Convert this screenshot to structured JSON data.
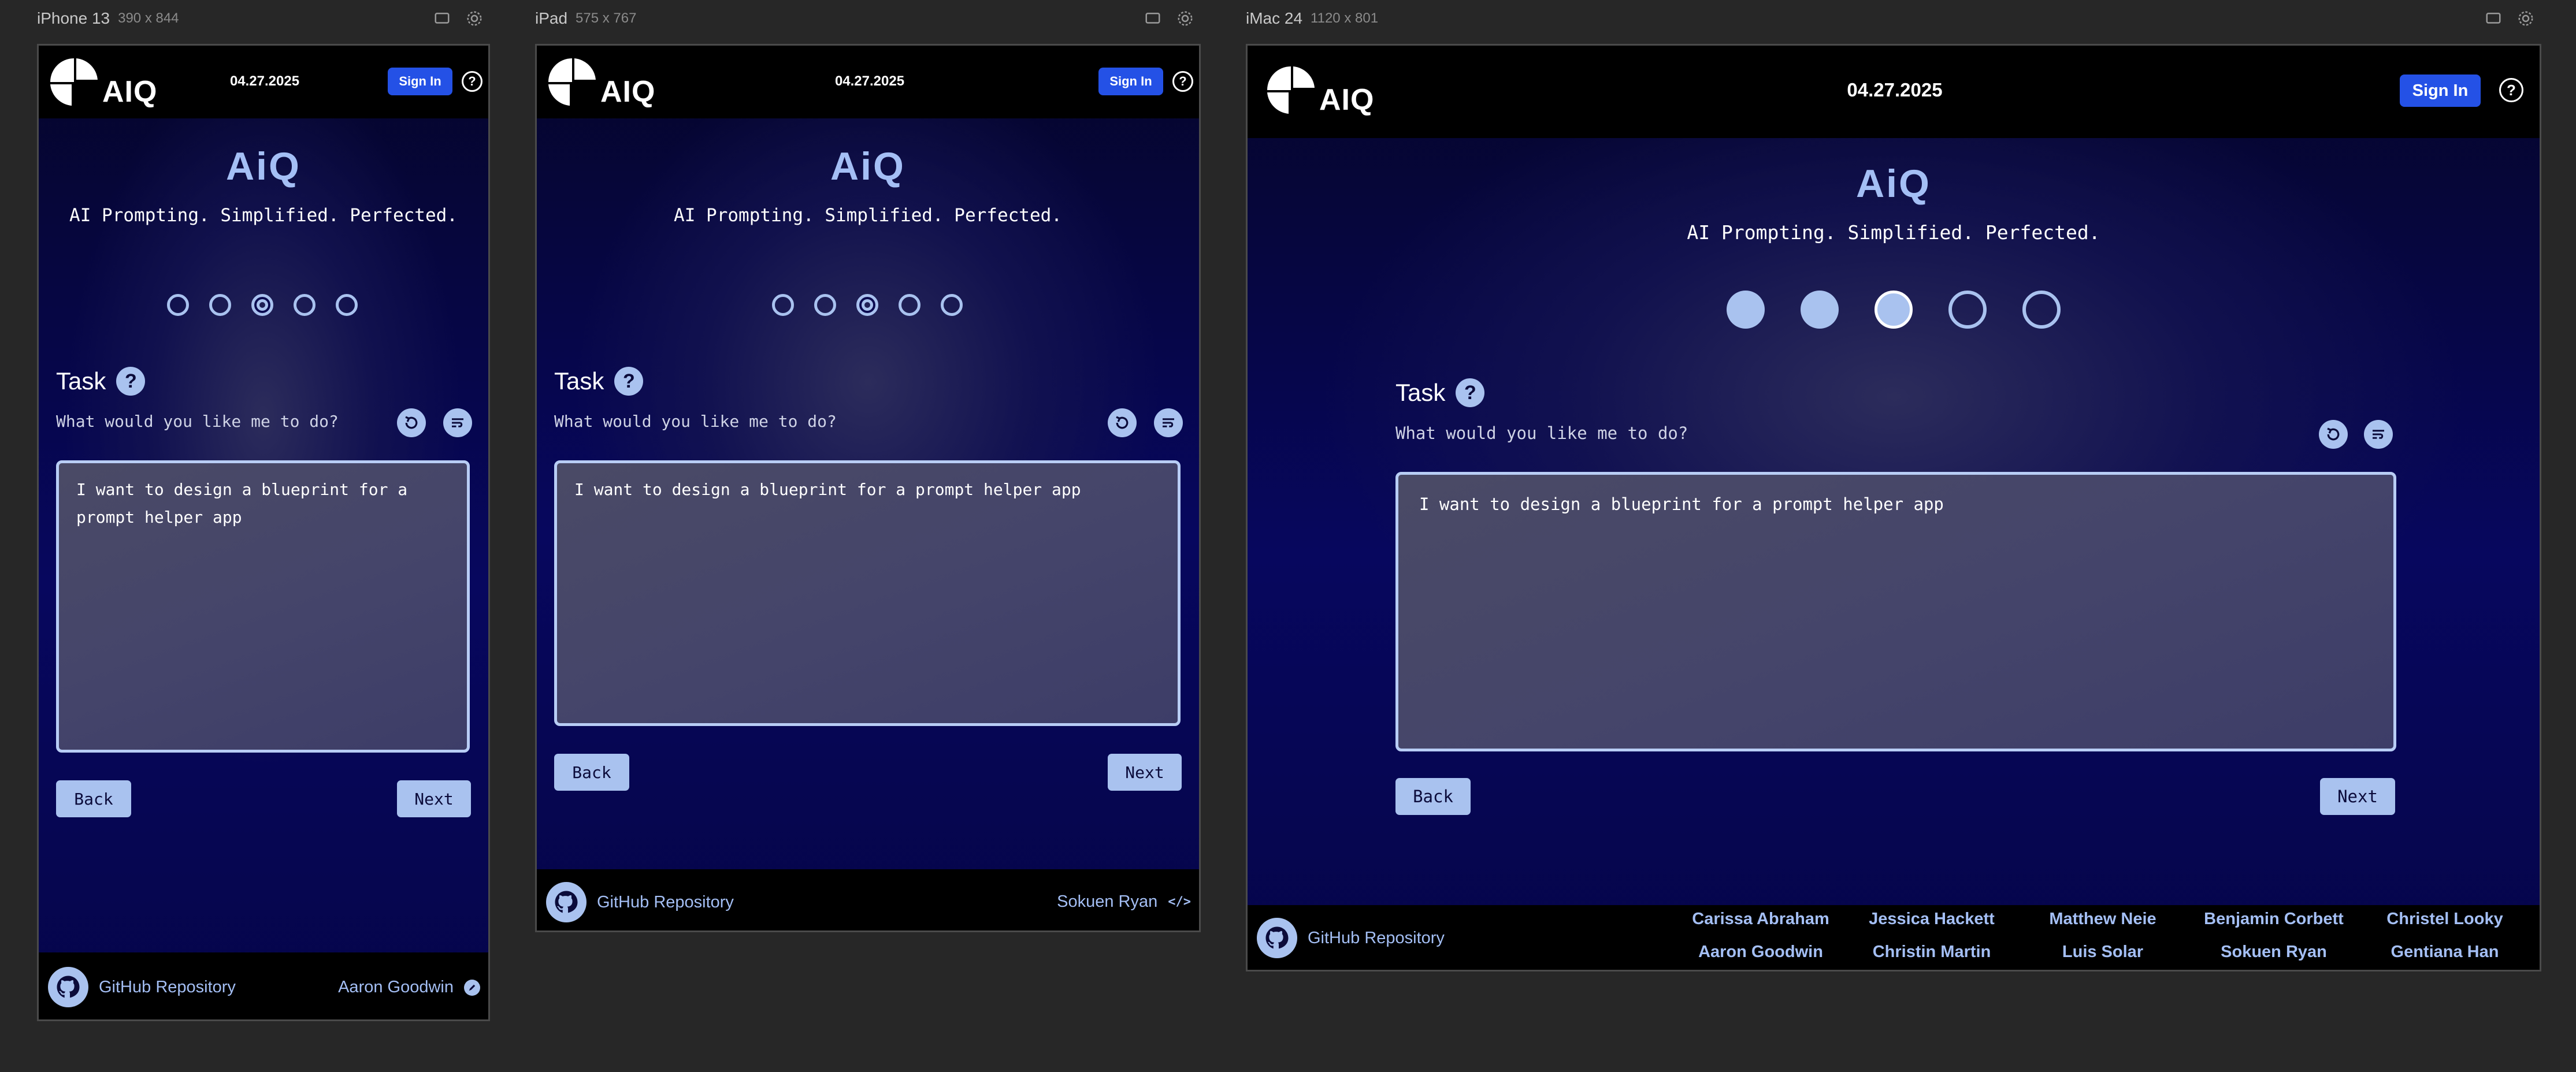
{
  "devices": [
    {
      "name": "iPhone 13",
      "size": "390 x 844"
    },
    {
      "name": "iPad",
      "size": "575 x 767"
    },
    {
      "name": "iMac 24",
      "size": "1120 x 801"
    }
  ],
  "app": {
    "logo_text": "AIQ",
    "date": "04.27.2025",
    "sign_in": "Sign In",
    "help_glyph": "?",
    "title": "AiQ",
    "tagline": "AI Prompting. Simplified. Perfected.",
    "steps_total": 5,
    "current_step": 3,
    "task_title": "Task",
    "task_help_glyph": "?",
    "task_question": "What would you like me to do?",
    "task_value": "I want to design a blueprint for a prompt helper app",
    "back": "Back",
    "next": "Next",
    "github": "GitHub Repository",
    "icons": [
      "reset-icon",
      "format-icon",
      "github-icon",
      "help-icon",
      "pencil-icon",
      "code-icon",
      "monitor-icon",
      "gear-icon"
    ]
  },
  "authors": {
    "iphone": "Aaron Goodwin",
    "ipad": "Sokuen Ryan"
  },
  "credits": [
    "Carissa Abraham",
    "Jessica Hackett",
    "Matthew Neie",
    "Benjamin Corbett",
    "Christel Looky",
    "Aaron Goodwin",
    "Christin Martin",
    "Luis Solar",
    "Sokuen Ryan",
    "Gentiana Han"
  ],
  "colors": {
    "canvas": "#272727",
    "header": "#000000",
    "accent": "#a9c2ef",
    "sign_in": "#2451e6",
    "title": "#a4bff5"
  }
}
